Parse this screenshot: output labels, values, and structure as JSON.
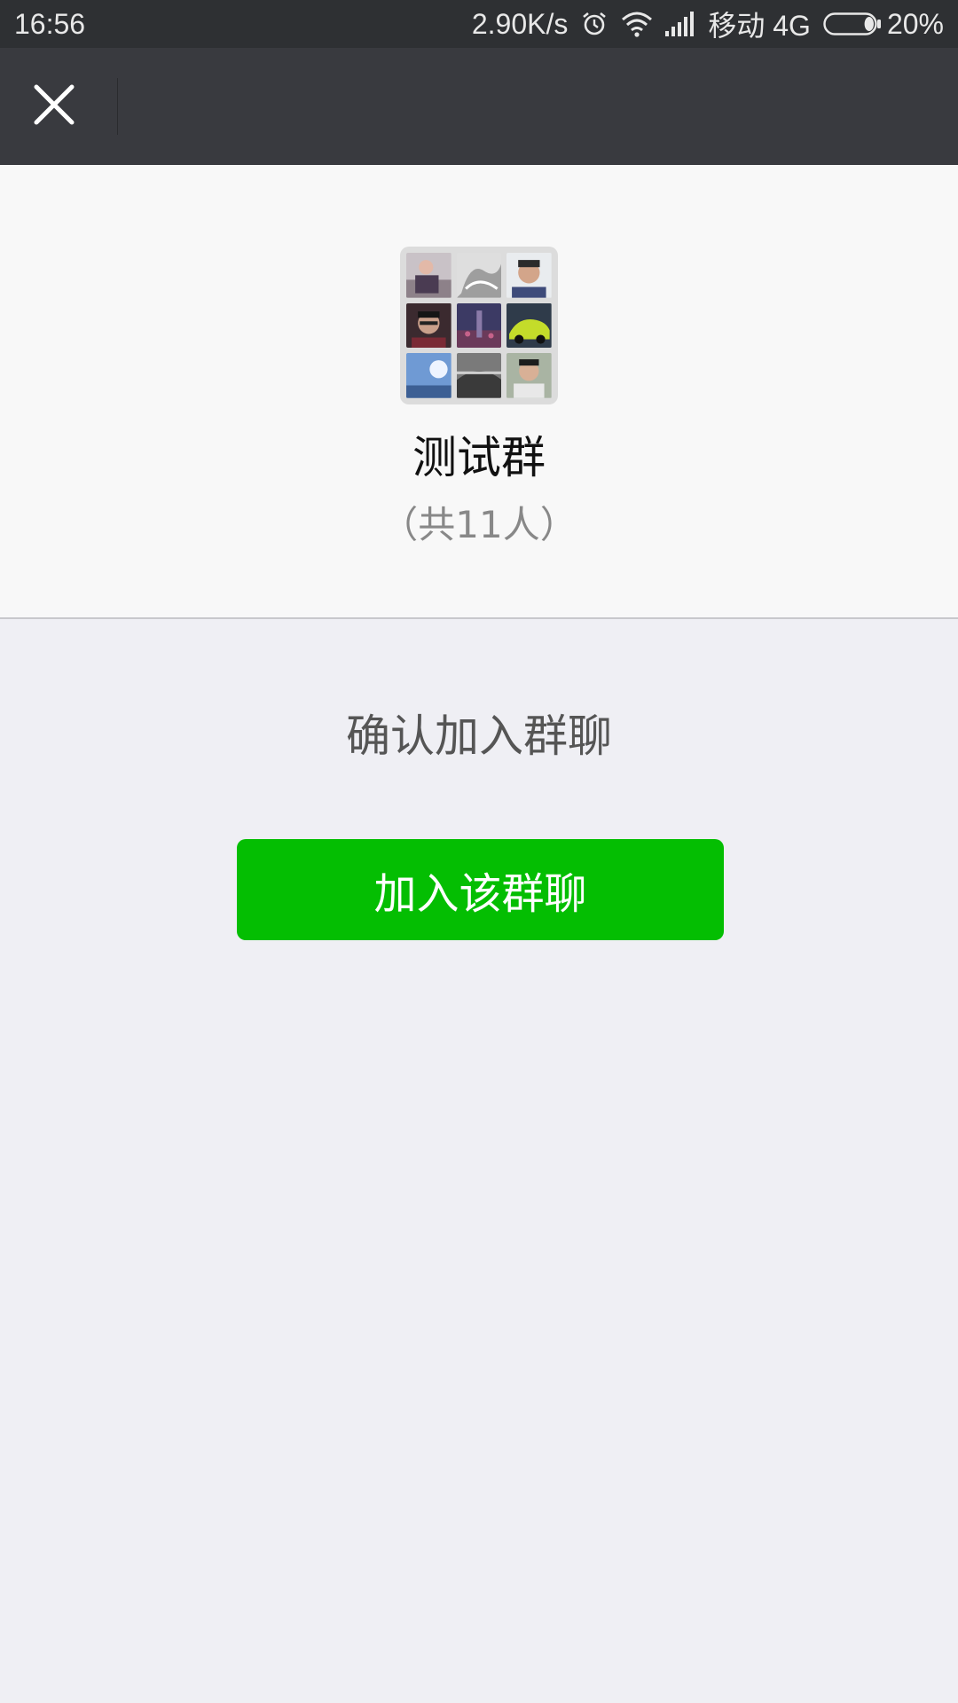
{
  "status_bar": {
    "time": "16:56",
    "network_speed": "2.90K/s",
    "carrier": "移动 4G",
    "battery_percent_text": "20%",
    "battery_level": 0.2,
    "icons": [
      "alarm-icon",
      "wifi-icon",
      "signal-icon",
      "battery-icon"
    ]
  },
  "title_bar": {
    "close_icon": "close-icon",
    "background_color": "#393a3f"
  },
  "group": {
    "avatar_icon": "group-avatar-grid",
    "name": "测试群",
    "member_count": "（共11人）"
  },
  "main": {
    "confirm_text": "确认加入群聊",
    "join_button_label": "加入该群聊",
    "accent_color": "#04be02"
  }
}
